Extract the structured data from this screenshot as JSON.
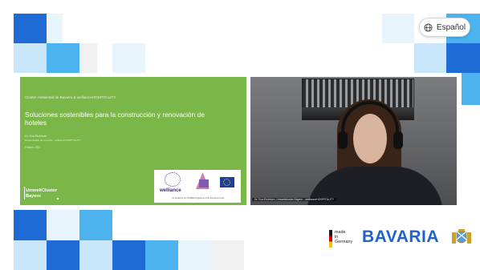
{
  "language_button": {
    "label": "Español",
    "icon": "globe-icon"
  },
  "slide": {
    "header": "Cluster Ambiental de Baviera & wellianceHOSPITALITY",
    "title": "Soluciones sostenibles para la construcción y renovación de hoteles",
    "author": "Dr. Eva Eichhorn",
    "role": "Responsable de proyecto, wellianceHOSPITALITY",
    "date": "Febrero 2021",
    "umwelt_line1": "UmweltCluster",
    "umwelt_line2": "Bayern",
    "welliance": "welliance",
    "cofunded": "Co-funded by the COSME Programme of the European Union"
  },
  "webcam": {
    "caption": "Dr. Eva Eichhorn, Umweltcluster Bayern - wellianceHOSPITALITY"
  },
  "branding": {
    "made_in": "made\nin\nGermany",
    "wordmark": "BAVARIA"
  },
  "colors": {
    "slide_green": "#7ab648",
    "brand_blue": "#1f63c6",
    "tile_blue": "#1f6bd6",
    "tile_sky": "#4db3ef"
  }
}
